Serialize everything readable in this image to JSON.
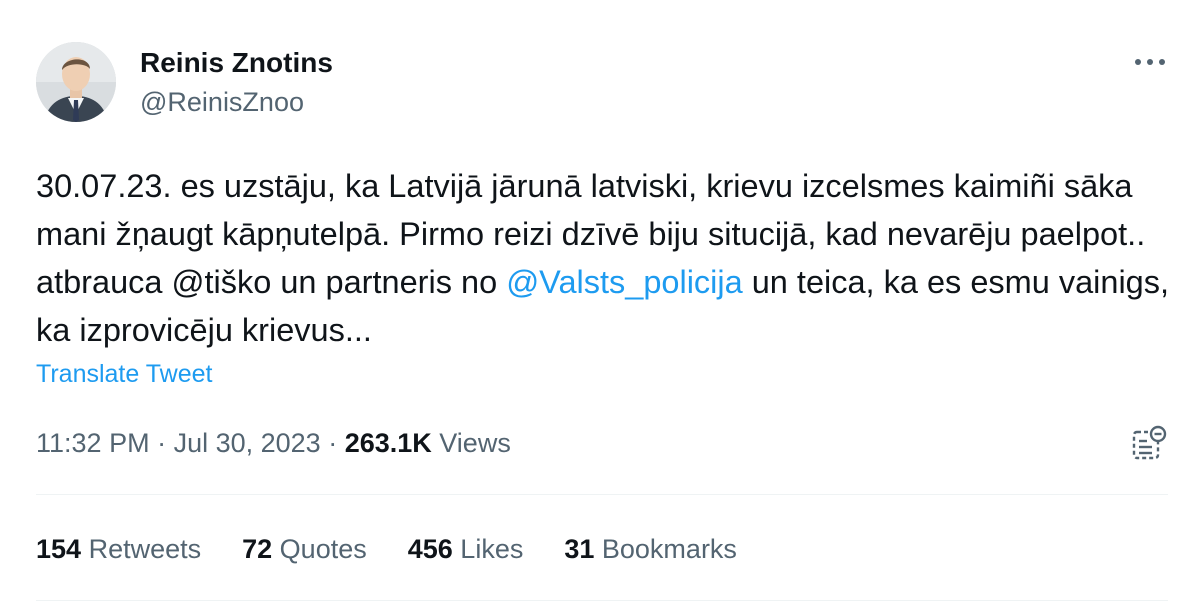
{
  "author": {
    "display_name": "Reinis Znotins",
    "handle": "@ReinisZnoo"
  },
  "tweet": {
    "text_before_mention": "30.07.23. es uzstāju, ka Latvijā jārunā latviski, krievu izcelsmes kaimiñi sāka mani žņaugt kāpņutelpā. Pirmo reizi dzīvē biju situcijā, kad nevarēju paelpot.. atbrauca @tiško un partneris no ",
    "mention": "@Valsts_policija",
    "text_after_mention": "  un teica, ka es esmu vainigs, ka izprovicēju krievus...",
    "translate_label": "Translate Tweet"
  },
  "meta": {
    "time": "11:32 PM",
    "separator": " · ",
    "date": "Jul 30, 2023",
    "views_count": "263.1K",
    "views_label": " Views"
  },
  "stats": [
    {
      "count": "154",
      "label": " Retweets"
    },
    {
      "count": "72",
      "label": " Quotes"
    },
    {
      "count": "456",
      "label": " Likes"
    },
    {
      "count": "31",
      "label": " Bookmarks"
    }
  ],
  "icons": {
    "more": "more-horizontal-icon",
    "analytics": "analytics-icon"
  },
  "colors": {
    "link": "#1d9bf0",
    "secondary_text": "#536471",
    "primary_text": "#0f1419"
  }
}
